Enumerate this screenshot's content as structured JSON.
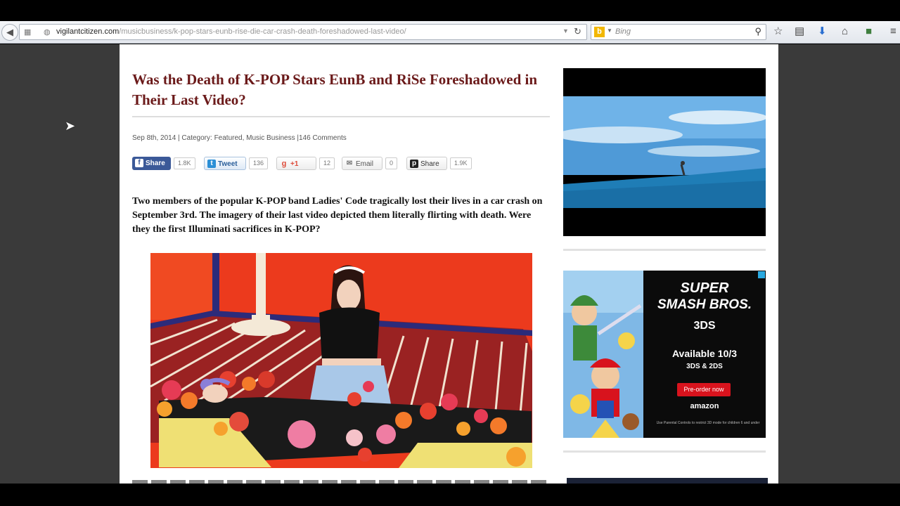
{
  "browser": {
    "url_host": "vigilantcitizen.com",
    "url_path": "/musicbusiness/k-pop-stars-eunb-rise-die-car-crash-death-foreshadowed-last-video/",
    "search_placeholder": "Bing"
  },
  "article": {
    "title": "Was the Death of K-POP Stars EunB and RiSe Foreshadowed in Their Last Video?",
    "meta": "Sep 8th, 2014 | Category: Featured, Music Business |146 Comments",
    "lead": "Two members of the popular K-POP band Ladies' Code tragically lost their lives in a car crash on September 3rd. The imagery of their last video depicted them literally flirting with death. Were they the first Illuminati sacrifices in K-POP?"
  },
  "share": {
    "facebook": {
      "label": "Share",
      "count": "1.8K",
      "color": "#3b5998"
    },
    "twitter": {
      "label": "Tweet",
      "count": "136",
      "color": "#2b8fd6"
    },
    "gplus": {
      "label": "+1",
      "count": "12",
      "color": "#dd4b39"
    },
    "email": {
      "label": "Email",
      "count": "0"
    },
    "pinterest": {
      "label": "Share",
      "count": "1.9K"
    }
  },
  "ad": {
    "title_line1": "SUPER",
    "title_line2": "SMASH BROS.",
    "platform": "3DS",
    "available": "Available 10/3",
    "systems": "3DS & 2DS",
    "cta": "Pre-order now",
    "brand": "amazon",
    "fine_print": "Use Parental Controls to restrict 3D mode for children 6 and under"
  }
}
